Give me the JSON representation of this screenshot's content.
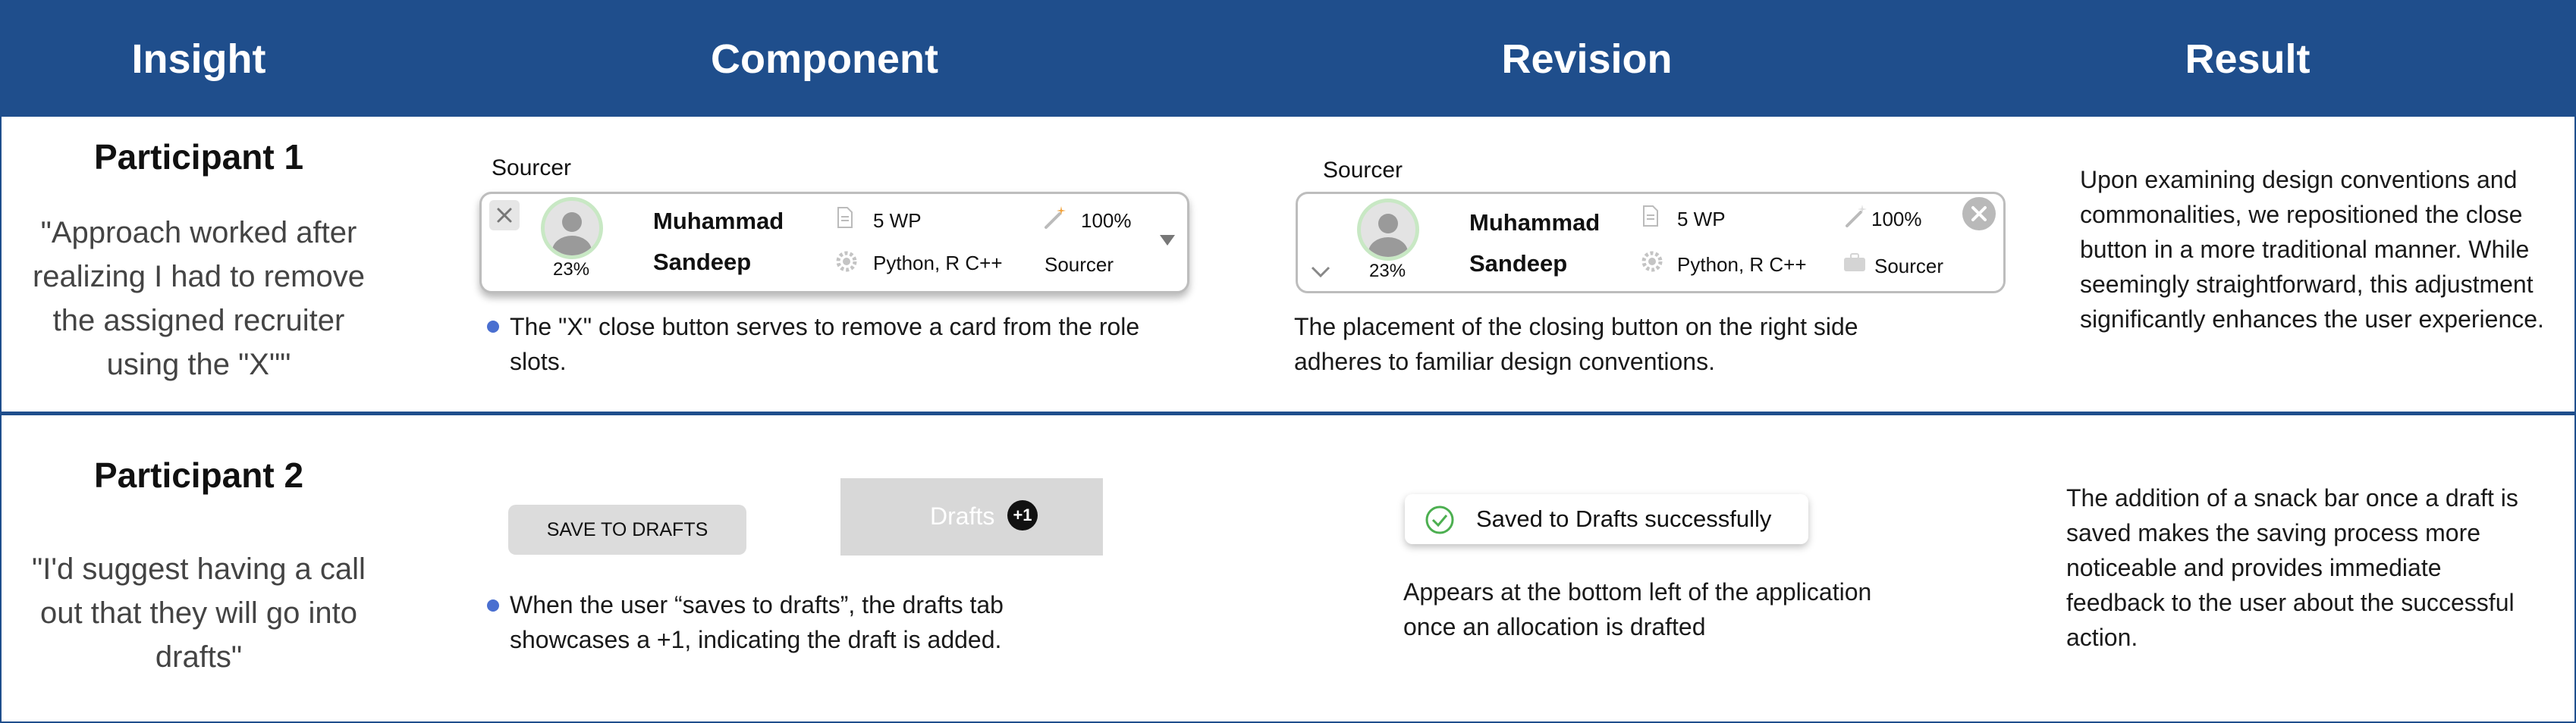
{
  "header": {
    "columns": [
      "Insight",
      "Component",
      "Revision",
      "Result"
    ]
  },
  "colors": {
    "header_bg": "#1f4e8c",
    "bullet": "#4a6fd0",
    "avatar_ring": "#c8e8c4",
    "success": "#4caf50"
  },
  "rows": [
    {
      "participant": "Participant 1",
      "quote": "\"Approach worked after realizing I had to remove the assigned recruiter using the \"X\"\"",
      "component": {
        "label": "Sourcer",
        "card": {
          "first_name": "Muhammad",
          "last_name": "Sandeep",
          "percent": "23%",
          "wp": "5 WP",
          "skills": "Python, R C++",
          "match": "100%",
          "role": "Sourcer"
        },
        "note": "The \"X\" close button serves to remove a card from the role slots."
      },
      "revision": {
        "label": "Sourcer",
        "card": {
          "first_name": "Muhammad",
          "last_name": "Sandeep",
          "percent": "23%",
          "wp": "5 WP",
          "skills": "Python, R C++",
          "match": "100%",
          "role": "Sourcer"
        },
        "note": "The placement of the closing button on the right side adheres to familiar design conventions."
      },
      "result": "Upon examining design conventions and commonalities, we repositioned the close button in a more traditional manner. While seemingly straightforward, this adjustment significantly enhances the user experience."
    },
    {
      "participant": "Participant 2",
      "quote": "\"I'd suggest having a call out that they will go into drafts\"",
      "component": {
        "save_button": "SAVE TO DRAFTS",
        "drafts_tab": "Drafts",
        "drafts_badge": "+1",
        "note": "When the user “saves to drafts”, the drafts tab showcases a +1, indicating the draft is added."
      },
      "revision": {
        "snackbar": "Saved to Drafts successfully",
        "note": "Appears at the bottom left of the application once an allocation is drafted"
      },
      "result": "The addition of a snack bar once a draft is saved makes the saving process more noticeable and provides immediate feedback to the user about the successful action."
    }
  ]
}
